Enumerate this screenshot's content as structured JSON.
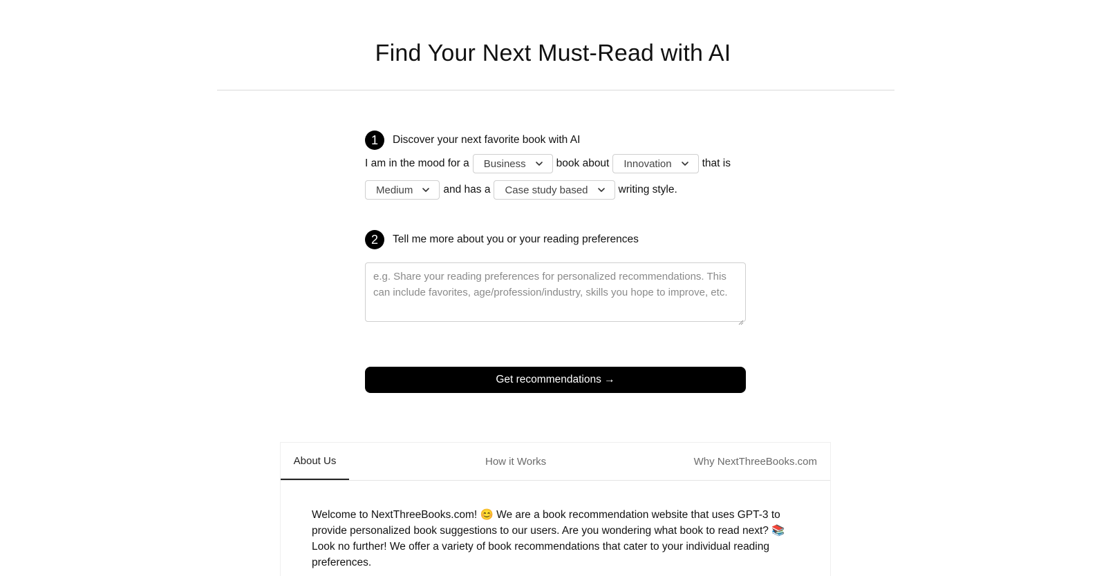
{
  "header": {
    "title": "Find Your Next Must-Read with AI"
  },
  "step1": {
    "number": "1",
    "label": "Discover your next favorite book with AI",
    "text_mood": "I am in the mood for a",
    "genre_value": "Business",
    "text_book_about": "book about",
    "topic_value": "Innovation",
    "text_that_is": "that is",
    "length_value": "Medium",
    "text_and_has": "and has a",
    "style_value": "Case study based",
    "text_writing_style": "writing style."
  },
  "step2": {
    "number": "2",
    "label": "Tell me more about you or your reading preferences",
    "placeholder": "e.g.  Share your reading preferences for personalized recommendations. This can include favorites, age/profession/industry, skills you hope to improve, etc."
  },
  "cta": {
    "label": "Get recommendations →"
  },
  "tabs": {
    "items": [
      {
        "label": "About Us",
        "active": true
      },
      {
        "label": "How it Works",
        "active": false
      },
      {
        "label": "Why NextThreeBooks.com",
        "active": false
      }
    ]
  },
  "about": {
    "text": "Welcome to NextThreeBooks.com! 😊 We are a book recommendation website that uses GPT-3 to provide personalized book suggestions to our users. Are you wondering what book to read next? 📚 Look no further! We offer a variety of book recommendations that cater to your individual reading preferences."
  },
  "icons": {
    "select_arrow": "chevron-down-icon",
    "textarea_resize": "resize-grip-icon"
  },
  "colors": {
    "accent": "#000000",
    "border": "#cfcfcf",
    "placeholder": "#8a8a8a",
    "tab_inactive": "#6b6b6b"
  }
}
